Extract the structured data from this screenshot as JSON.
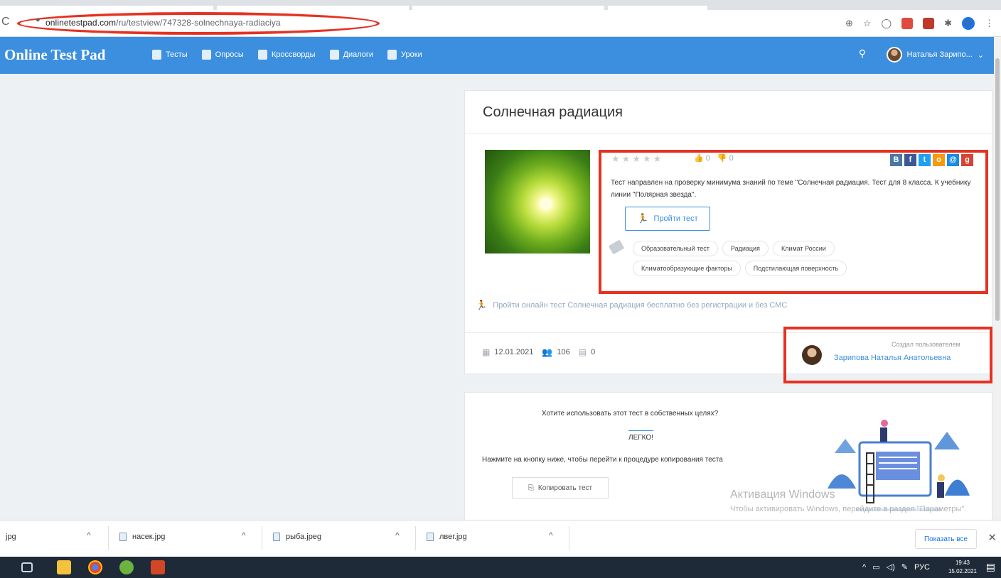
{
  "browser": {
    "url_host": "onlinetestpad.com",
    "url_path": "/ru/testview/747328-solnechnaya-radiaciya",
    "reload_glyph": "C",
    "lock_glyph": "🔒",
    "profile_initial": "D"
  },
  "site": {
    "logo": "Online Test Pad",
    "nav": [
      "Тесты",
      "Опросы",
      "Кроссворды",
      "Диалоги",
      "Уроки"
    ],
    "user": "Наталья Зарипо..."
  },
  "test": {
    "title": "Солнечная радиация",
    "likes": "0",
    "dislikes": "0",
    "description": "Тест направлен на проверку минимума знаний по теме \"Солнечная радиация. Тест для 8 класса. К учебнику линии \"Полярная звезда\".",
    "take_button": "Пройти тест",
    "tags": [
      "Образовательный тест",
      "Радиация",
      "Климат России",
      "Климатообразующие факторы",
      "Подстилающая поверхность"
    ],
    "online_line": "Пройти онлайн тест Солнечная радиация бесплатно без регистрации и без СМС",
    "date": "12.01.2021",
    "participants": "106",
    "comments": "0",
    "created_by": "Создал пользователем",
    "author": "Зарипова Наталья Анатольевна"
  },
  "copy": {
    "question": "Хотите использовать этот тест в собственных целях?",
    "easy": "ЛЕГКО!",
    "hint": "Нажмите на кнопку ниже, чтобы перейти к процедуре копирования теста",
    "button": "Копировать тест"
  },
  "windows": {
    "activation_title": "Активация Windows",
    "activation_text": "Чтобы активировать Windows, перейдите в раздел \"Параметры\"."
  },
  "downloads": {
    "items": [
      "jpg",
      "насек.jpg",
      "рыба.jpeg",
      "лвег.jpg"
    ],
    "show_all": "Показать все"
  },
  "taskbar": {
    "lang": "РУС",
    "time": "19:43",
    "date": "15.02.2021"
  },
  "colors": {
    "nav_blue": "#3c8fdf",
    "annotation_red": "#e53222"
  }
}
